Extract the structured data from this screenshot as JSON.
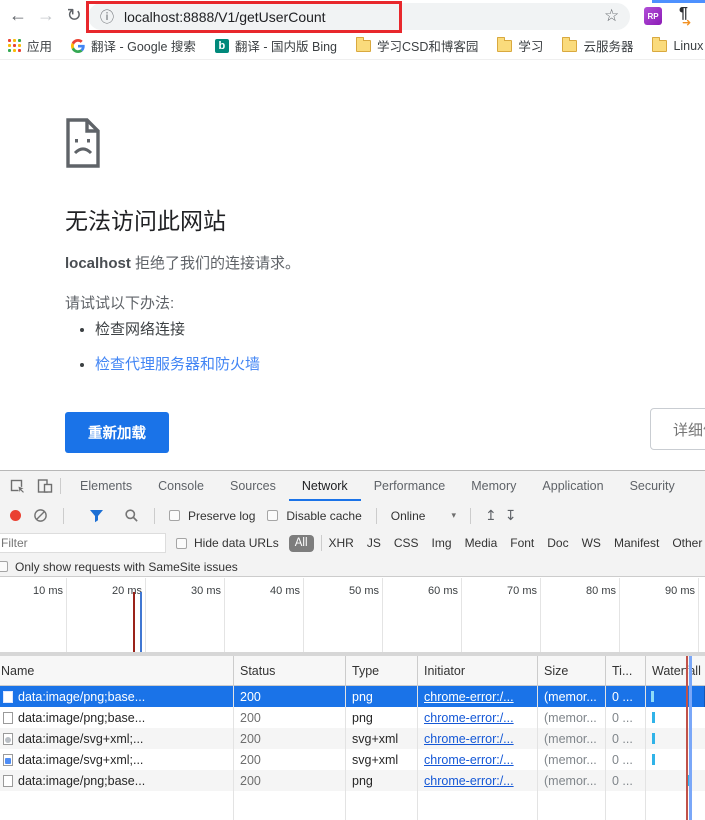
{
  "colors": {
    "accent_blue": "#1a73e8",
    "annotation_red": "#e8272c",
    "selected_row": "#1a73e8",
    "link_blue": "#1558d6",
    "waterfall_tick": "#30b3e8"
  },
  "icons": {
    "back": "←",
    "forward": "→",
    "reload": "↻",
    "info": "ⓘ",
    "star": "☆",
    "caret_down": "▾",
    "import": "↥",
    "export": "↧",
    "translate_ext_glyph": "¶",
    "translate_ext_arrow": "➜",
    "rp_ext": "RP",
    "bing": "b"
  },
  "browser": {
    "url": "localhost:8888/V1/getUserCount",
    "bookmarks": [
      {
        "label": "应用",
        "icon": "apps-grid"
      },
      {
        "label": "翻译 - Google 搜索",
        "icon": "google"
      },
      {
        "label": "翻译 - 国内版 Bing",
        "icon": "bing"
      },
      {
        "label": "学习CSD和博客园",
        "icon": "folder"
      },
      {
        "label": "学习",
        "icon": "folder"
      },
      {
        "label": "云服务器",
        "icon": "folder"
      },
      {
        "label": "Linux",
        "icon": "folder"
      }
    ]
  },
  "error_page": {
    "title": "无法访问此网站",
    "message_host": "localhost",
    "message_rest": " 拒绝了我们的连接请求。",
    "suggestion_heading": "请试试以下办法:",
    "suggestions": [
      {
        "label": "检查网络连接"
      },
      {
        "label": "检查代理服务器和防火墙"
      }
    ],
    "reload_button": "重新加载",
    "details_button": "详细信息"
  },
  "devtools": {
    "tabs": [
      {
        "label": "Elements"
      },
      {
        "label": "Console"
      },
      {
        "label": "Sources"
      },
      {
        "label": "Network"
      },
      {
        "label": "Performance"
      },
      {
        "label": "Memory"
      },
      {
        "label": "Application"
      },
      {
        "label": "Security"
      }
    ],
    "active_tab": "Network",
    "network_bar": {
      "preserve_log": "Preserve log",
      "disable_cache": "Disable cache",
      "throttling": "Online"
    },
    "filter_bar": {
      "placeholder": "Filter",
      "hide_data_urls": "Hide data URLs",
      "types": [
        {
          "label": "All",
          "active": true
        },
        {
          "label": "XHR"
        },
        {
          "label": "JS"
        },
        {
          "label": "CSS"
        },
        {
          "label": "Img"
        },
        {
          "label": "Media"
        },
        {
          "label": "Font"
        },
        {
          "label": "Doc"
        },
        {
          "label": "WS"
        },
        {
          "label": "Manifest"
        },
        {
          "label": "Other"
        }
      ]
    },
    "samesite_label": "Only show requests with SameSite issues",
    "timeline_ticks": [
      {
        "label": "10 ms"
      },
      {
        "label": "20 ms"
      },
      {
        "label": "30 ms"
      },
      {
        "label": "40 ms"
      },
      {
        "label": "50 ms"
      },
      {
        "label": "60 ms"
      },
      {
        "label": "70 ms"
      },
      {
        "label": "80 ms"
      },
      {
        "label": "90 ms"
      }
    ],
    "table": {
      "columns": {
        "name": "Name",
        "status": "Status",
        "type": "Type",
        "initiator": "Initiator",
        "size": "Size",
        "time": "Ti...",
        "waterfall": "Waterfall"
      },
      "rows": [
        {
          "name": "data:image/png;base...",
          "status": "200",
          "type": "png",
          "initiator": "chrome-error:/...",
          "size": "(memor...",
          "time": "0 ...",
          "selected": true
        },
        {
          "name": "data:image/png;base...",
          "status": "200",
          "type": "png",
          "initiator": "chrome-error:/...",
          "size": "(memor...",
          "time": "0 ...",
          "selected": false
        },
        {
          "name": "data:image/svg+xml;...",
          "status": "200",
          "type": "svg+xml",
          "initiator": "chrome-error:/...",
          "size": "(memor...",
          "time": "0 ...",
          "selected": false
        },
        {
          "name": "data:image/svg+xml;...",
          "status": "200",
          "type": "svg+xml",
          "initiator": "chrome-error:/...",
          "size": "(memor...",
          "time": "0 ...",
          "selected": false
        },
        {
          "name": "data:image/png;base...",
          "status": "200",
          "type": "png",
          "initiator": "chrome-error:/...",
          "size": "(memor...",
          "time": "0 ...",
          "selected": false
        }
      ]
    }
  }
}
